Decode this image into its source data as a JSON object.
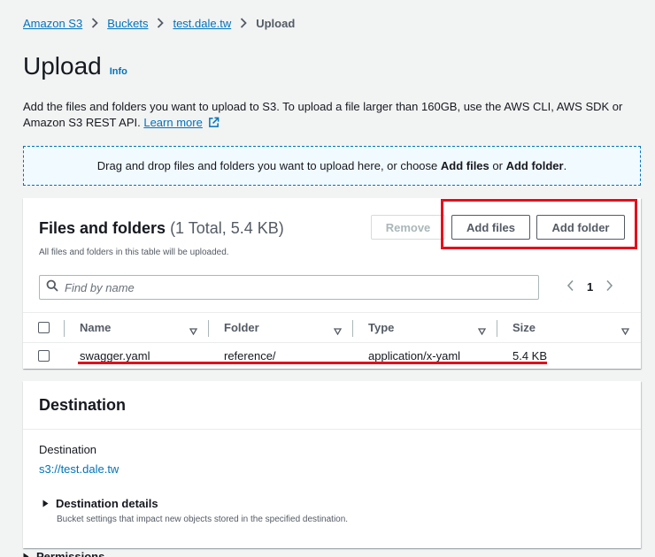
{
  "breadcrumb": {
    "items": [
      {
        "label": "Amazon S3"
      },
      {
        "label": "Buckets"
      },
      {
        "label": "test.dale.tw"
      }
    ],
    "current": "Upload"
  },
  "page": {
    "title": "Upload",
    "info_label": "Info",
    "description": "Add the files and folders you want to upload to S3. To upload a file larger than 160GB, use the AWS CLI, AWS SDK or Amazon S3 REST API.",
    "learn_more": "Learn more"
  },
  "dropzone": {
    "text_before": "Drag and drop files and folders you want to upload here, or choose ",
    "add_files": "Add files",
    "or": " or ",
    "add_folder": "Add folder",
    "period": "."
  },
  "files_panel": {
    "title": "Files and folders",
    "count": "(1 Total, 5.4 KB)",
    "subtitle": "All files and folders in this table will be uploaded.",
    "remove_label": "Remove",
    "add_files_label": "Add files",
    "add_folder_label": "Add folder",
    "search_placeholder": "Find by name",
    "current_page": "1",
    "columns": [
      "Name",
      "Folder",
      "Type",
      "Size"
    ],
    "rows": [
      {
        "name": "swagger.yaml",
        "folder": "reference/",
        "type": "application/x-yaml",
        "size": "5.4 KB"
      }
    ]
  },
  "destination_panel": {
    "title": "Destination",
    "label": "Destination",
    "value": "s3://test.dale.tw",
    "details_title": "Destination details",
    "details_subtitle": "Bucket settings that impact new objects stored in the specified destination."
  },
  "next_section": {
    "title": "Permissions"
  },
  "colors": {
    "link": "#0073bb",
    "highlight": "#e4101b",
    "dropzone_bg": "#f1faff"
  }
}
